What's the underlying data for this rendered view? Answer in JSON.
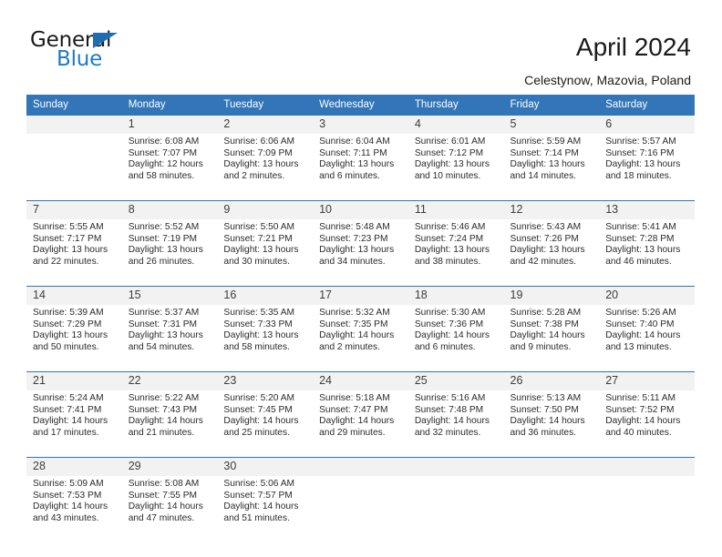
{
  "logo": {
    "word_one": "General",
    "word_two": "Blue",
    "triangle_color": "#1f6cb0",
    "blue_color": "#1f7ac4"
  },
  "header": {
    "title": "April 2024",
    "location": "Celestynow, Mazovia, Poland"
  },
  "theme": {
    "header_blue": "#3275b8",
    "daynum_bg": "#f2f2f2",
    "text": "#2b2b2b"
  },
  "calendar": {
    "weekday_headers": [
      "Sunday",
      "Monday",
      "Tuesday",
      "Wednesday",
      "Thursday",
      "Friday",
      "Saturday"
    ],
    "weeks": [
      {
        "days": [
          {
            "num": "",
            "sunrise": "",
            "sunset": "",
            "daylight_1": "",
            "daylight_2": ""
          },
          {
            "num": "1",
            "sunrise": "Sunrise: 6:08 AM",
            "sunset": "Sunset: 7:07 PM",
            "daylight_1": "Daylight: 12 hours",
            "daylight_2": "and 58 minutes."
          },
          {
            "num": "2",
            "sunrise": "Sunrise: 6:06 AM",
            "sunset": "Sunset: 7:09 PM",
            "daylight_1": "Daylight: 13 hours",
            "daylight_2": "and 2 minutes."
          },
          {
            "num": "3",
            "sunrise": "Sunrise: 6:04 AM",
            "sunset": "Sunset: 7:11 PM",
            "daylight_1": "Daylight: 13 hours",
            "daylight_2": "and 6 minutes."
          },
          {
            "num": "4",
            "sunrise": "Sunrise: 6:01 AM",
            "sunset": "Sunset: 7:12 PM",
            "daylight_1": "Daylight: 13 hours",
            "daylight_2": "and 10 minutes."
          },
          {
            "num": "5",
            "sunrise": "Sunrise: 5:59 AM",
            "sunset": "Sunset: 7:14 PM",
            "daylight_1": "Daylight: 13 hours",
            "daylight_2": "and 14 minutes."
          },
          {
            "num": "6",
            "sunrise": "Sunrise: 5:57 AM",
            "sunset": "Sunset: 7:16 PM",
            "daylight_1": "Daylight: 13 hours",
            "daylight_2": "and 18 minutes."
          }
        ]
      },
      {
        "days": [
          {
            "num": "7",
            "sunrise": "Sunrise: 5:55 AM",
            "sunset": "Sunset: 7:17 PM",
            "daylight_1": "Daylight: 13 hours",
            "daylight_2": "and 22 minutes."
          },
          {
            "num": "8",
            "sunrise": "Sunrise: 5:52 AM",
            "sunset": "Sunset: 7:19 PM",
            "daylight_1": "Daylight: 13 hours",
            "daylight_2": "and 26 minutes."
          },
          {
            "num": "9",
            "sunrise": "Sunrise: 5:50 AM",
            "sunset": "Sunset: 7:21 PM",
            "daylight_1": "Daylight: 13 hours",
            "daylight_2": "and 30 minutes."
          },
          {
            "num": "10",
            "sunrise": "Sunrise: 5:48 AM",
            "sunset": "Sunset: 7:23 PM",
            "daylight_1": "Daylight: 13 hours",
            "daylight_2": "and 34 minutes."
          },
          {
            "num": "11",
            "sunrise": "Sunrise: 5:46 AM",
            "sunset": "Sunset: 7:24 PM",
            "daylight_1": "Daylight: 13 hours",
            "daylight_2": "and 38 minutes."
          },
          {
            "num": "12",
            "sunrise": "Sunrise: 5:43 AM",
            "sunset": "Sunset: 7:26 PM",
            "daylight_1": "Daylight: 13 hours",
            "daylight_2": "and 42 minutes."
          },
          {
            "num": "13",
            "sunrise": "Sunrise: 5:41 AM",
            "sunset": "Sunset: 7:28 PM",
            "daylight_1": "Daylight: 13 hours",
            "daylight_2": "and 46 minutes."
          }
        ]
      },
      {
        "days": [
          {
            "num": "14",
            "sunrise": "Sunrise: 5:39 AM",
            "sunset": "Sunset: 7:29 PM",
            "daylight_1": "Daylight: 13 hours",
            "daylight_2": "and 50 minutes."
          },
          {
            "num": "15",
            "sunrise": "Sunrise: 5:37 AM",
            "sunset": "Sunset: 7:31 PM",
            "daylight_1": "Daylight: 13 hours",
            "daylight_2": "and 54 minutes."
          },
          {
            "num": "16",
            "sunrise": "Sunrise: 5:35 AM",
            "sunset": "Sunset: 7:33 PM",
            "daylight_1": "Daylight: 13 hours",
            "daylight_2": "and 58 minutes."
          },
          {
            "num": "17",
            "sunrise": "Sunrise: 5:32 AM",
            "sunset": "Sunset: 7:35 PM",
            "daylight_1": "Daylight: 14 hours",
            "daylight_2": "and 2 minutes."
          },
          {
            "num": "18",
            "sunrise": "Sunrise: 5:30 AM",
            "sunset": "Sunset: 7:36 PM",
            "daylight_1": "Daylight: 14 hours",
            "daylight_2": "and 6 minutes."
          },
          {
            "num": "19",
            "sunrise": "Sunrise: 5:28 AM",
            "sunset": "Sunset: 7:38 PM",
            "daylight_1": "Daylight: 14 hours",
            "daylight_2": "and 9 minutes."
          },
          {
            "num": "20",
            "sunrise": "Sunrise: 5:26 AM",
            "sunset": "Sunset: 7:40 PM",
            "daylight_1": "Daylight: 14 hours",
            "daylight_2": "and 13 minutes."
          }
        ]
      },
      {
        "days": [
          {
            "num": "21",
            "sunrise": "Sunrise: 5:24 AM",
            "sunset": "Sunset: 7:41 PM",
            "daylight_1": "Daylight: 14 hours",
            "daylight_2": "and 17 minutes."
          },
          {
            "num": "22",
            "sunrise": "Sunrise: 5:22 AM",
            "sunset": "Sunset: 7:43 PM",
            "daylight_1": "Daylight: 14 hours",
            "daylight_2": "and 21 minutes."
          },
          {
            "num": "23",
            "sunrise": "Sunrise: 5:20 AM",
            "sunset": "Sunset: 7:45 PM",
            "daylight_1": "Daylight: 14 hours",
            "daylight_2": "and 25 minutes."
          },
          {
            "num": "24",
            "sunrise": "Sunrise: 5:18 AM",
            "sunset": "Sunset: 7:47 PM",
            "daylight_1": "Daylight: 14 hours",
            "daylight_2": "and 29 minutes."
          },
          {
            "num": "25",
            "sunrise": "Sunrise: 5:16 AM",
            "sunset": "Sunset: 7:48 PM",
            "daylight_1": "Daylight: 14 hours",
            "daylight_2": "and 32 minutes."
          },
          {
            "num": "26",
            "sunrise": "Sunrise: 5:13 AM",
            "sunset": "Sunset: 7:50 PM",
            "daylight_1": "Daylight: 14 hours",
            "daylight_2": "and 36 minutes."
          },
          {
            "num": "27",
            "sunrise": "Sunrise: 5:11 AM",
            "sunset": "Sunset: 7:52 PM",
            "daylight_1": "Daylight: 14 hours",
            "daylight_2": "and 40 minutes."
          }
        ]
      },
      {
        "days": [
          {
            "num": "28",
            "sunrise": "Sunrise: 5:09 AM",
            "sunset": "Sunset: 7:53 PM",
            "daylight_1": "Daylight: 14 hours",
            "daylight_2": "and 43 minutes."
          },
          {
            "num": "29",
            "sunrise": "Sunrise: 5:08 AM",
            "sunset": "Sunset: 7:55 PM",
            "daylight_1": "Daylight: 14 hours",
            "daylight_2": "and 47 minutes."
          },
          {
            "num": "30",
            "sunrise": "Sunrise: 5:06 AM",
            "sunset": "Sunset: 7:57 PM",
            "daylight_1": "Daylight: 14 hours",
            "daylight_2": "and 51 minutes."
          },
          {
            "num": "",
            "sunrise": "",
            "sunset": "",
            "daylight_1": "",
            "daylight_2": ""
          },
          {
            "num": "",
            "sunrise": "",
            "sunset": "",
            "daylight_1": "",
            "daylight_2": ""
          },
          {
            "num": "",
            "sunrise": "",
            "sunset": "",
            "daylight_1": "",
            "daylight_2": ""
          },
          {
            "num": "",
            "sunrise": "",
            "sunset": "",
            "daylight_1": "",
            "daylight_2": ""
          }
        ]
      }
    ]
  }
}
